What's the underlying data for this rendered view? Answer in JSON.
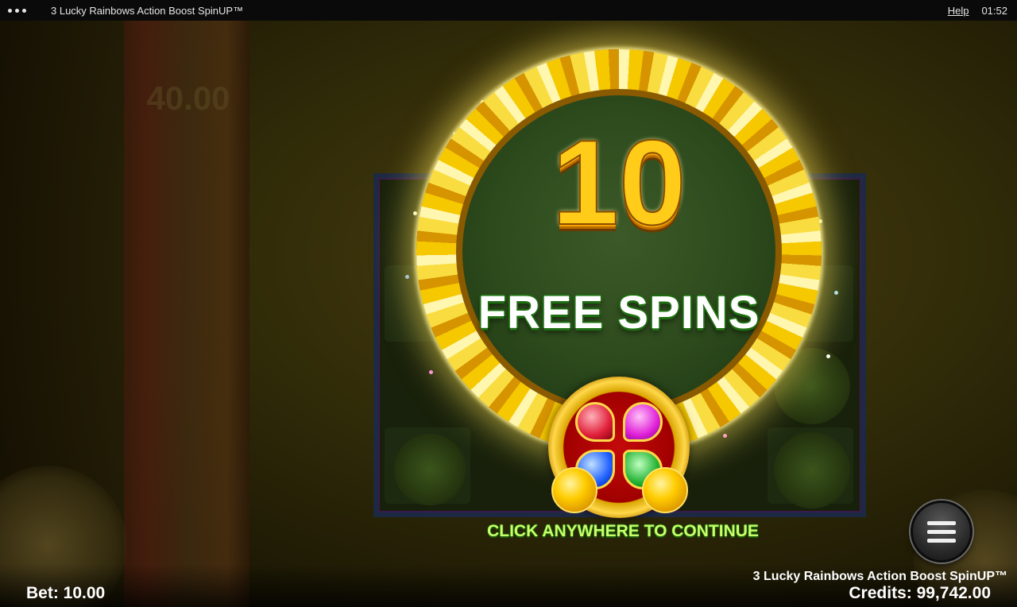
{
  "topbar": {
    "title": "3 Lucky Rainbows Action Boost SpinUP™",
    "help_label": "Help",
    "clock": "01:52"
  },
  "background": {
    "ghost_value": "40.00"
  },
  "popup": {
    "spins_count": "10",
    "spins_label": "FREE SPINS",
    "continue_prompt": "CLICK ANYWHERE TO CONTINUE"
  },
  "footer": {
    "game_name": "3 Lucky Rainbows Action Boost SpinUP™",
    "bet": "Bet: 10.00",
    "credits": "Credits: 99,742.00"
  },
  "colors": {
    "ring_gold": "#f6c800",
    "center_green": "#2c4a1c",
    "number_gold": "#ffcc1a",
    "label_outline_green": "#1d6e10",
    "prompt_green": "#c8ff6a",
    "emblem_red": "#c40a0a"
  },
  "icons": {
    "menu": "hamburger-menu-icon",
    "more": "more-dots-icon",
    "emblem": "four-leaf-clover-icon"
  }
}
